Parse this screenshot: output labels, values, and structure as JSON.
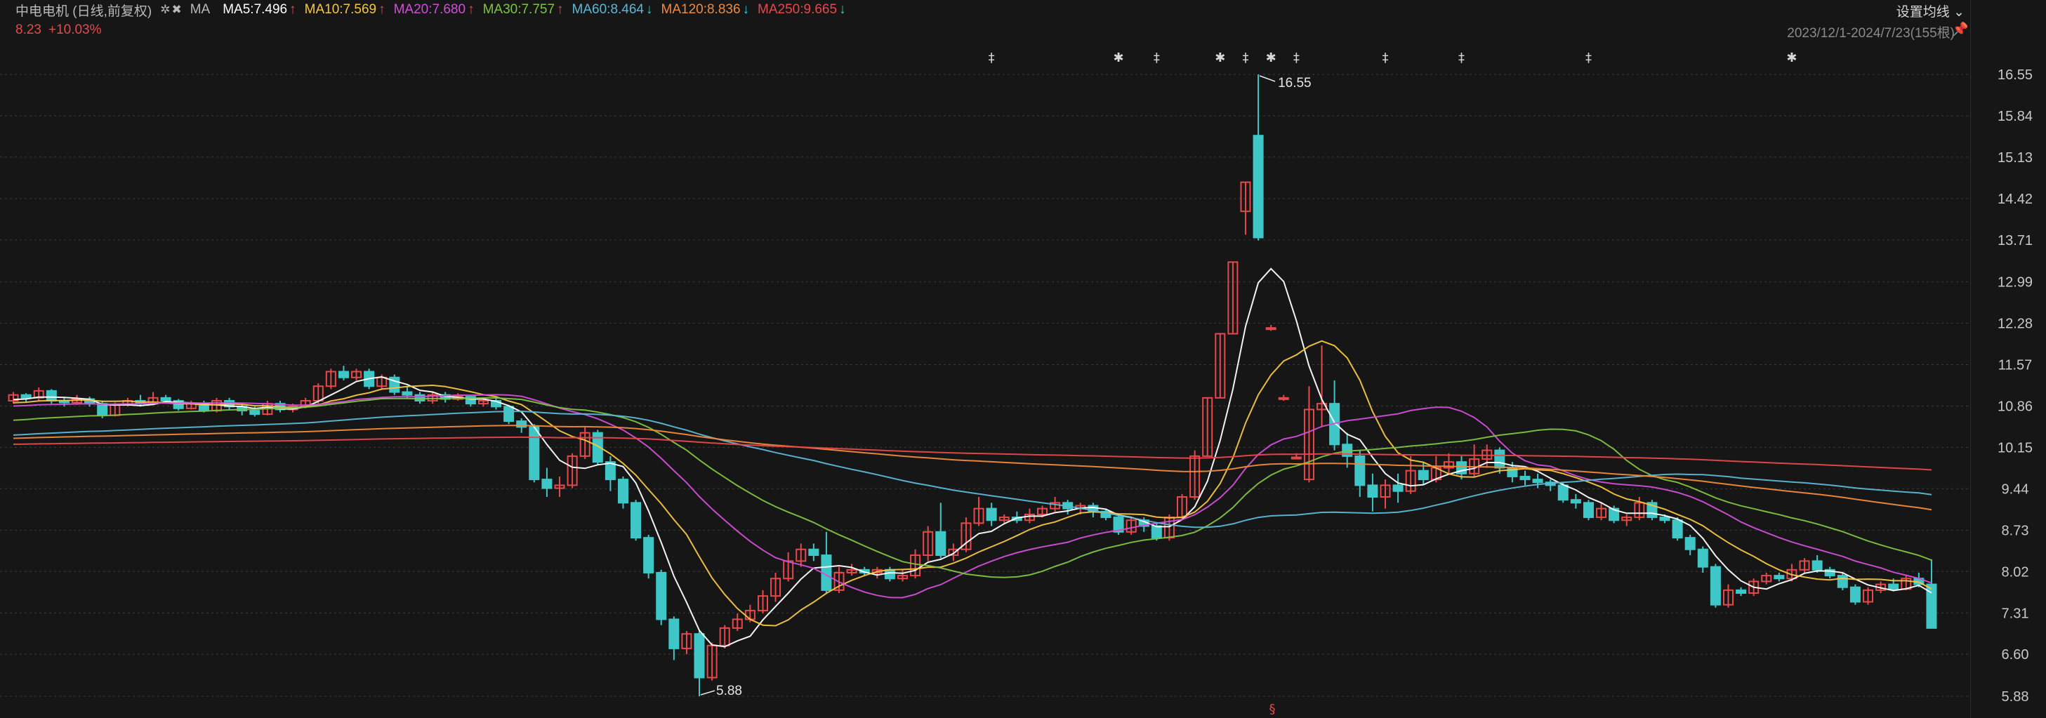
{
  "header": {
    "title": "中电电机 (日线,前复权)",
    "tools_icons": "✲✖",
    "ma_label": "MA",
    "ma_items": [
      {
        "label": "MA5:7.496",
        "arrow": "↑",
        "color": "#ffffff"
      },
      {
        "label": "MA10:7.569",
        "arrow": "↑",
        "color": "#f5c542"
      },
      {
        "label": "MA20:7.680",
        "arrow": "↑",
        "color": "#d14fd6"
      },
      {
        "label": "MA30:7.757",
        "arrow": "↑",
        "color": "#7fc241"
      },
      {
        "label": "MA60:8.464",
        "arrow": "↓",
        "color": "#5cb8d6"
      },
      {
        "label": "MA120:8.836",
        "arrow": "↓",
        "color": "#f08a3c"
      },
      {
        "label": "MA250:9.665",
        "arrow": "↓",
        "color": "#e8484a"
      }
    ]
  },
  "quote": {
    "price": "8.23",
    "change": "+10.03%"
  },
  "settings_label": "设置均线 ⌄",
  "range_label": "2023/12/1-2024/7/23(155根)",
  "pin_icon": "📌",
  "colors": {
    "up": "#e8484a",
    "down": "#3fc7c7",
    "grid": "#3a3a3c"
  },
  "chart_data": {
    "type": "candlestick",
    "y_ticks": [
      "16.55",
      "15.84",
      "15.13",
      "14.42",
      "13.71",
      "12.99",
      "12.28",
      "11.57",
      "10.86",
      "10.15",
      "9.44",
      "8.73",
      "8.02",
      "7.31",
      "6.60",
      "5.88"
    ],
    "ylim": [
      5.88,
      16.55
    ],
    "annotations": [
      {
        "text": "16.55",
        "type": "high"
      },
      {
        "text": "5.88",
        "type": "low"
      }
    ],
    "event_markers": [
      "‡",
      "✱",
      "‡",
      "✱",
      "‡",
      "✱",
      "‡",
      "‡",
      "‡",
      "‡",
      "✱"
    ],
    "bottom_marker": "§",
    "series_ma": [
      "MA5",
      "MA10",
      "MA20",
      "MA30",
      "MA60",
      "MA120",
      "MA250"
    ],
    "candles": [
      [
        10.95,
        11.05,
        11.1,
        10.9
      ],
      [
        11.05,
        11.0,
        11.08,
        10.92
      ],
      [
        11.0,
        11.12,
        11.18,
        10.95
      ],
      [
        11.12,
        10.95,
        11.15,
        10.9
      ],
      [
        10.95,
        10.92,
        11.0,
        10.85
      ],
      [
        10.92,
        10.98,
        11.05,
        10.88
      ],
      [
        10.98,
        10.9,
        11.02,
        10.85
      ],
      [
        10.9,
        10.7,
        10.95,
        10.65
      ],
      [
        10.7,
        10.88,
        10.92,
        10.68
      ],
      [
        10.88,
        10.95,
        11.0,
        10.85
      ],
      [
        10.95,
        10.9,
        11.05,
        10.85
      ],
      [
        10.9,
        11.0,
        11.1,
        10.88
      ],
      [
        11.0,
        10.95,
        11.05,
        10.9
      ],
      [
        10.95,
        10.82,
        10.98,
        10.78
      ],
      [
        10.82,
        10.9,
        10.95,
        10.8
      ],
      [
        10.9,
        10.78,
        10.95,
        10.75
      ],
      [
        10.78,
        10.95,
        11.0,
        10.75
      ],
      [
        10.95,
        10.85,
        11.0,
        10.8
      ],
      [
        10.85,
        10.78,
        10.9,
        10.7
      ],
      [
        10.78,
        10.72,
        10.85,
        10.68
      ],
      [
        10.72,
        10.9,
        10.95,
        10.7
      ],
      [
        10.9,
        10.8,
        10.95,
        10.75
      ],
      [
        10.8,
        10.85,
        10.9,
        10.75
      ],
      [
        10.85,
        10.95,
        11.0,
        10.82
      ],
      [
        10.95,
        11.2,
        11.25,
        10.9
      ],
      [
        11.2,
        11.45,
        11.5,
        11.15
      ],
      [
        11.45,
        11.35,
        11.55,
        11.3
      ],
      [
        11.35,
        11.45,
        11.5,
        11.3
      ],
      [
        11.45,
        11.2,
        11.5,
        11.15
      ],
      [
        11.2,
        11.35,
        11.4,
        11.15
      ],
      [
        11.35,
        11.1,
        11.4,
        11.05
      ],
      [
        11.1,
        11.05,
        11.2,
        11.0
      ],
      [
        11.05,
        10.95,
        11.1,
        10.9
      ],
      [
        10.95,
        11.05,
        11.1,
        10.9
      ],
      [
        11.05,
        10.98,
        11.1,
        10.92
      ],
      [
        10.98,
        11.02,
        11.08,
        10.95
      ],
      [
        11.02,
        10.9,
        11.05,
        10.85
      ],
      [
        10.9,
        10.95,
        11.0,
        10.85
      ],
      [
        10.95,
        10.85,
        11.0,
        10.8
      ],
      [
        10.85,
        10.6,
        10.88,
        10.55
      ],
      [
        10.6,
        10.5,
        10.65,
        10.4
      ],
      [
        10.5,
        9.6,
        10.55,
        9.55
      ],
      [
        9.6,
        9.45,
        9.8,
        9.3
      ],
      [
        9.45,
        9.5,
        9.65,
        9.3
      ],
      [
        9.5,
        10.0,
        10.05,
        9.45
      ],
      [
        10.0,
        10.4,
        10.5,
        9.95
      ],
      [
        10.4,
        9.9,
        10.45,
        9.85
      ],
      [
        9.9,
        9.6,
        10.0,
        9.4
      ],
      [
        9.6,
        9.2,
        9.65,
        9.1
      ],
      [
        9.2,
        8.6,
        9.25,
        8.55
      ],
      [
        8.6,
        8.0,
        8.65,
        7.9
      ],
      [
        8.0,
        7.2,
        8.05,
        7.1
      ],
      [
        7.2,
        6.7,
        7.25,
        6.5
      ],
      [
        6.7,
        6.95,
        7.0,
        6.6
      ],
      [
        6.95,
        6.2,
        7.0,
        5.88
      ],
      [
        6.2,
        6.75,
        6.8,
        6.15
      ],
      [
        6.75,
        7.05,
        7.1,
        6.7
      ],
      [
        7.05,
        7.2,
        7.3,
        7.0
      ],
      [
        7.2,
        7.35,
        7.45,
        7.15
      ],
      [
        7.35,
        7.6,
        7.7,
        7.3
      ],
      [
        7.6,
        7.9,
        8.0,
        7.5
      ],
      [
        7.9,
        8.2,
        8.35,
        7.85
      ],
      [
        8.2,
        8.4,
        8.5,
        8.1
      ],
      [
        8.4,
        8.3,
        8.5,
        8.2
      ],
      [
        8.3,
        7.7,
        8.7,
        7.65
      ],
      [
        7.7,
        8.0,
        8.1,
        7.65
      ],
      [
        8.0,
        8.05,
        8.15,
        7.95
      ],
      [
        8.05,
        8.0,
        8.1,
        7.95
      ],
      [
        8.0,
        8.05,
        8.1,
        7.9
      ],
      [
        8.05,
        7.9,
        8.1,
        7.85
      ],
      [
        7.9,
        7.95,
        8.05,
        7.85
      ],
      [
        7.95,
        8.3,
        8.4,
        7.9
      ],
      [
        8.3,
        8.7,
        8.8,
        8.2
      ],
      [
        8.7,
        8.3,
        9.2,
        8.25
      ],
      [
        8.3,
        8.4,
        8.5,
        8.2
      ],
      [
        8.4,
        8.85,
        8.95,
        8.35
      ],
      [
        8.85,
        9.1,
        9.3,
        8.8
      ],
      [
        9.1,
        8.9,
        9.2,
        8.8
      ],
      [
        8.9,
        8.95,
        9.0,
        8.85
      ],
      [
        8.95,
        8.9,
        9.05,
        8.85
      ],
      [
        8.9,
        9.0,
        9.1,
        8.85
      ],
      [
        9.0,
        9.1,
        9.15,
        8.95
      ],
      [
        9.1,
        9.2,
        9.3,
        9.05
      ],
      [
        9.2,
        9.1,
        9.25,
        9.0
      ],
      [
        9.1,
        9.15,
        9.2,
        9.0
      ],
      [
        9.15,
        9.05,
        9.2,
        8.95
      ],
      [
        9.05,
        8.95,
        9.1,
        8.9
      ],
      [
        8.95,
        8.7,
        9.0,
        8.65
      ],
      [
        8.7,
        8.9,
        8.95,
        8.65
      ],
      [
        8.9,
        8.8,
        8.95,
        8.7
      ],
      [
        8.8,
        8.6,
        8.85,
        8.55
      ],
      [
        8.6,
        8.95,
        9.0,
        8.55
      ],
      [
        8.95,
        9.3,
        9.35,
        8.9
      ],
      [
        9.3,
        10.0,
        10.1,
        9.25
      ],
      [
        10.0,
        11.0,
        11.0,
        10.0
      ],
      [
        11.0,
        12.1,
        12.1,
        11.0
      ],
      [
        12.1,
        13.33,
        13.33,
        12.1
      ],
      [
        14.2,
        14.7,
        14.7,
        13.8
      ],
      [
        15.5,
        13.75,
        16.55,
        13.7
      ],
      [
        12.2,
        12.2,
        12.25,
        12.15
      ],
      [
        11.0,
        11.0,
        11.05,
        10.95
      ],
      [
        9.98,
        9.98,
        10.05,
        9.95
      ],
      [
        9.6,
        10.8,
        11.2,
        9.55
      ],
      [
        10.8,
        10.9,
        11.9,
        10.5
      ],
      [
        10.9,
        10.2,
        11.3,
        10.1
      ],
      [
        10.2,
        10.0,
        10.4,
        9.8
      ],
      [
        10.0,
        9.5,
        10.1,
        9.3
      ],
      [
        9.5,
        9.3,
        9.7,
        9.05
      ],
      [
        9.3,
        9.5,
        9.6,
        9.1
      ],
      [
        9.5,
        9.4,
        9.7,
        9.2
      ],
      [
        9.4,
        9.75,
        10.0,
        9.35
      ],
      [
        9.75,
        9.6,
        9.9,
        9.5
      ],
      [
        9.6,
        9.8,
        10.0,
        9.55
      ],
      [
        9.8,
        9.9,
        10.05,
        9.7
      ],
      [
        9.9,
        9.7,
        10.0,
        9.6
      ],
      [
        9.7,
        9.95,
        10.2,
        9.65
      ],
      [
        9.95,
        10.1,
        10.2,
        9.8
      ],
      [
        10.1,
        9.8,
        10.15,
        9.7
      ],
      [
        9.8,
        9.65,
        9.9,
        9.55
      ],
      [
        9.65,
        9.6,
        9.75,
        9.5
      ],
      [
        9.6,
        9.55,
        9.7,
        9.45
      ],
      [
        9.55,
        9.5,
        9.6,
        9.4
      ],
      [
        9.5,
        9.25,
        9.55,
        9.2
      ],
      [
        9.25,
        9.2,
        9.35,
        9.1
      ],
      [
        9.2,
        8.95,
        9.25,
        8.9
      ],
      [
        8.95,
        9.1,
        9.2,
        8.9
      ],
      [
        9.1,
        8.9,
        9.15,
        8.85
      ],
      [
        8.9,
        8.95,
        9.0,
        8.8
      ],
      [
        8.95,
        9.2,
        9.3,
        8.9
      ],
      [
        9.2,
        8.95,
        9.25,
        8.9
      ],
      [
        8.95,
        8.9,
        9.0,
        8.85
      ],
      [
        8.9,
        8.6,
        8.95,
        8.55
      ],
      [
        8.6,
        8.4,
        8.65,
        8.3
      ],
      [
        8.4,
        8.1,
        8.45,
        8.0
      ],
      [
        8.1,
        7.45,
        8.15,
        7.4
      ],
      [
        7.45,
        7.7,
        7.8,
        7.4
      ],
      [
        7.7,
        7.65,
        7.75,
        7.6
      ],
      [
        7.65,
        7.85,
        7.9,
        7.6
      ],
      [
        7.85,
        7.95,
        8.0,
        7.8
      ],
      [
        7.95,
        7.9,
        8.0,
        7.85
      ],
      [
        7.9,
        8.05,
        8.15,
        7.85
      ],
      [
        8.05,
        8.2,
        8.25,
        8.0
      ],
      [
        8.2,
        8.05,
        8.3,
        8.0
      ],
      [
        8.05,
        7.95,
        8.1,
        7.9
      ],
      [
        7.95,
        7.75,
        8.0,
        7.7
      ],
      [
        7.75,
        7.5,
        7.8,
        7.45
      ],
      [
        7.5,
        7.7,
        7.75,
        7.45
      ],
      [
        7.7,
        7.8,
        7.85,
        7.65
      ],
      [
        7.8,
        7.72,
        7.9,
        7.68
      ],
      [
        7.72,
        7.9,
        7.95,
        7.7
      ],
      [
        7.9,
        7.8,
        8.0,
        7.75
      ],
      [
        7.8,
        7.05,
        8.23,
        7.05
      ]
    ]
  }
}
